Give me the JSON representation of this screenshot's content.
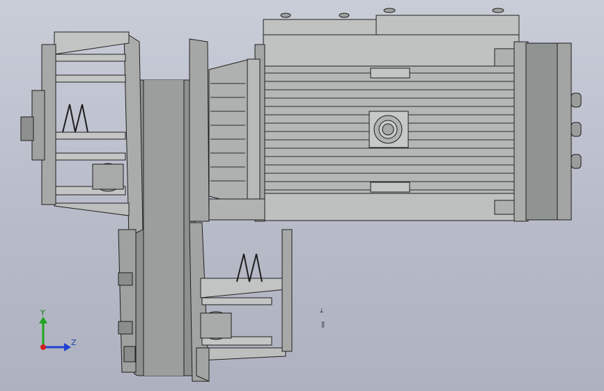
{
  "viewport": {
    "background_top": "#c9cdd8",
    "background_bottom": "#aeb2c0"
  },
  "model": {
    "description_icon": "gear-motor-assembly-icon",
    "fill_color": "#b9bcba",
    "edge_color": "#1e1e1e"
  },
  "triad": {
    "y_label": "Y",
    "z_label": "Z",
    "y_color": "#1fa51f",
    "z_color": "#1f3fd0",
    "x_color": "#d01f1f"
  },
  "marks": {
    "mark_1": "⊥",
    "mark_2": "‖"
  }
}
